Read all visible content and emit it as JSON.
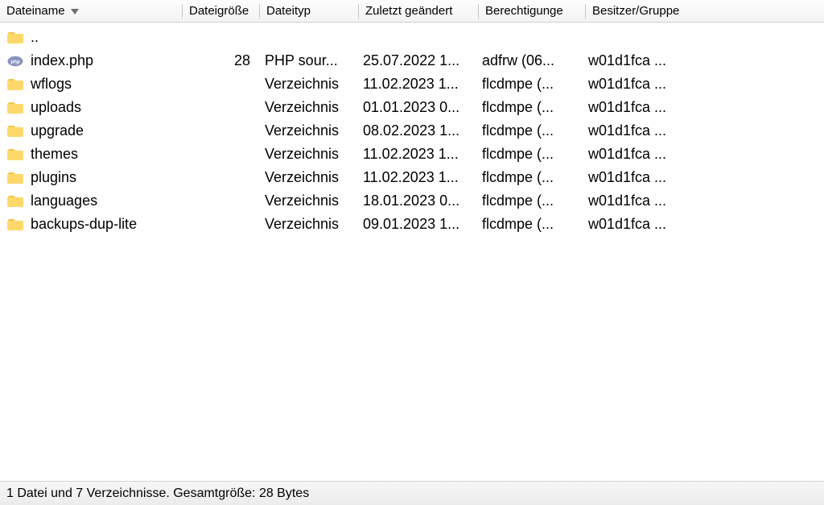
{
  "columns": {
    "name": "Dateiname",
    "size": "Dateigröße",
    "type": "Dateityp",
    "mod": "Zuletzt geändert",
    "perm": "Berechtigunge",
    "own": "Besitzer/Gruppe"
  },
  "sort": {
    "column": "name",
    "dir": "desc"
  },
  "rows": [
    {
      "icon": "folder",
      "name": "..",
      "size": "",
      "type": "",
      "mod": "",
      "perm": "",
      "own": ""
    },
    {
      "icon": "php",
      "name": "index.php",
      "size": "28",
      "type": "PHP sour...",
      "mod": "25.07.2022 1...",
      "perm": "adfrw (06...",
      "own": "w01d1fca ..."
    },
    {
      "icon": "folder",
      "name": "wflogs",
      "size": "",
      "type": "Verzeichnis",
      "mod": "11.02.2023 1...",
      "perm": "flcdmpe (...",
      "own": "w01d1fca ..."
    },
    {
      "icon": "folder",
      "name": "uploads",
      "size": "",
      "type": "Verzeichnis",
      "mod": "01.01.2023 0...",
      "perm": "flcdmpe (...",
      "own": "w01d1fca ..."
    },
    {
      "icon": "folder",
      "name": "upgrade",
      "size": "",
      "type": "Verzeichnis",
      "mod": "08.02.2023 1...",
      "perm": "flcdmpe (...",
      "own": "w01d1fca ..."
    },
    {
      "icon": "folder",
      "name": "themes",
      "size": "",
      "type": "Verzeichnis",
      "mod": "11.02.2023 1...",
      "perm": "flcdmpe (...",
      "own": "w01d1fca ..."
    },
    {
      "icon": "folder",
      "name": "plugins",
      "size": "",
      "type": "Verzeichnis",
      "mod": "11.02.2023 1...",
      "perm": "flcdmpe (...",
      "own": "w01d1fca ..."
    },
    {
      "icon": "folder",
      "name": "languages",
      "size": "",
      "type": "Verzeichnis",
      "mod": "18.01.2023 0...",
      "perm": "flcdmpe (...",
      "own": "w01d1fca ..."
    },
    {
      "icon": "folder",
      "name": "backups-dup-lite",
      "size": "",
      "type": "Verzeichnis",
      "mod": "09.01.2023 1...",
      "perm": "flcdmpe (...",
      "own": "w01d1fca ..."
    }
  ],
  "footer": "1 Datei und 7 Verzeichnisse. Gesamtgröße: 28 Bytes"
}
